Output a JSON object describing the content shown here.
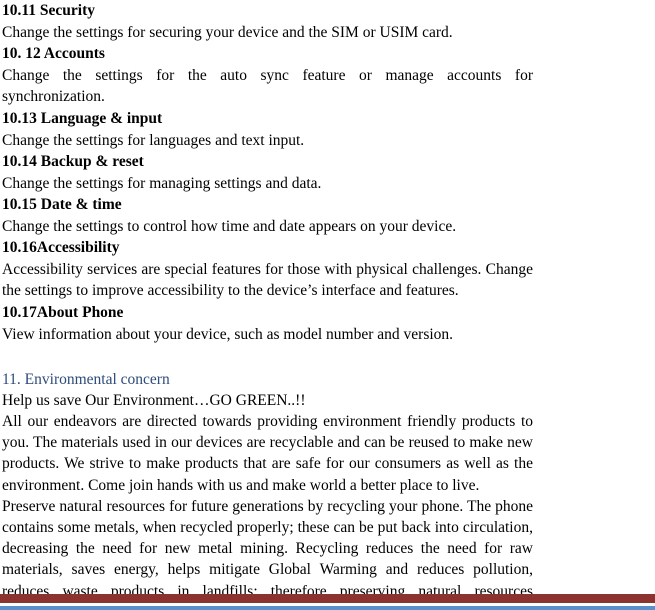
{
  "document": {
    "sections": [
      {
        "heading": "10.11 Security",
        "body": "Change the settings for securing your device and the SIM or USIM card.",
        "justify_all": false
      },
      {
        "heading": "10. 12 Accounts",
        "body": "Change the settings for the auto sync feature or manage accounts for synchronization.",
        "justify_all": false
      },
      {
        "heading": "10.13 Language & input",
        "body": "Change the settings for languages and text input.",
        "justify_all": false
      },
      {
        "heading": "10.14 Backup & reset",
        "body": "Change the settings for managing settings and data.",
        "justify_all": false
      },
      {
        "heading": "10.15 Date & time",
        "body": "Change the settings to control how time and date appears on your device.",
        "justify_all": false
      },
      {
        "heading": "10.16Accessibility",
        "body": "Accessibility services are special features for those with physical challenges. Change the settings to improve accessibility to the device’s interface and features.",
        "justify_all": false
      },
      {
        "heading": "10.17About Phone",
        "body": "View information about your device, such as model number and version.",
        "justify_all": false
      }
    ],
    "chapter": {
      "heading": "11. Environmental concern",
      "tagline": "Help us save Our Environment…GO GREEN..!!",
      "paragraphs": [
        "All our endeavors are directed towards providing environment friendly products to you. The materials used in our devices are recyclable and can be reused to make new products. We strive to make products that are safe for our consumers as well as the environment. Come join hands with us and make world a better place to live.",
        "Preserve natural resources for future generations by recycling your phone. The phone contains some metals, when recycled properly; these can be put back into circulation, decreasing the need for new metal mining. Recycling reduces the need for raw materials, saves energy, helps mitigate Global Warming and reduces pollution, reduces waste products in landfills; therefore preserving natural resources"
      ]
    },
    "colors": {
      "chapter_heading": "#2E4B7A",
      "footer_band": "#8C3330",
      "footer_rule": "#5B8FCB",
      "text": "#000000"
    }
  }
}
